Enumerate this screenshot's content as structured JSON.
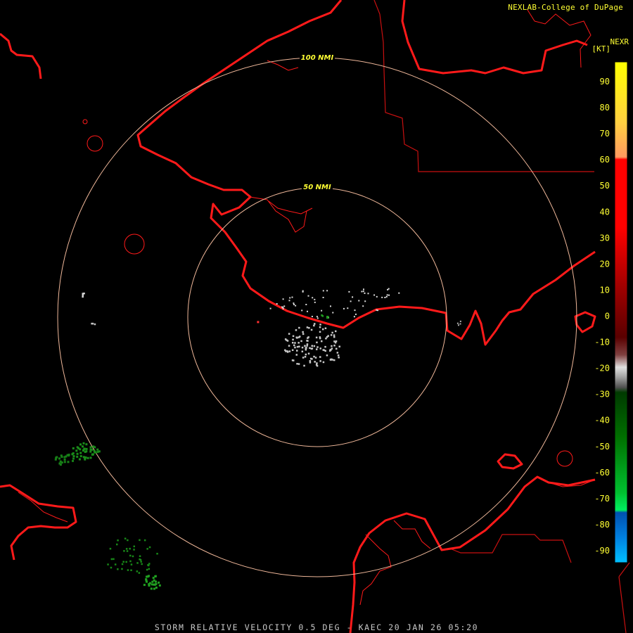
{
  "header": {
    "credit": "NEXLAB-College of DuPage",
    "product_code": "NEXR",
    "unit_label": "[KT]"
  },
  "range_rings": [
    {
      "label": "50 NMI"
    },
    {
      "label": "100 NMI"
    }
  ],
  "color_scale": {
    "tick_labels": [
      "90",
      "80",
      "70",
      "60",
      "50",
      "40",
      "30",
      "20",
      "10",
      "0",
      "-10",
      "-20",
      "-30",
      "-40",
      "-50",
      "-60",
      "-70",
      "-80",
      "-90"
    ],
    "tick_values": [
      90,
      80,
      70,
      60,
      50,
      40,
      30,
      20,
      10,
      0,
      -10,
      -20,
      -30,
      -40,
      -50,
      -60,
      -70,
      -80,
      -90
    ],
    "range": [
      -95,
      95
    ],
    "colors": {
      "high": "#ffff00",
      "outbound": "#ff0000",
      "near_zero": "#c8c8c8",
      "inbound": "#008c00",
      "strong_inbound": "#00c0ff"
    }
  },
  "caption": "STORM RELATIVE VELOCITY 0.5 DEG - KAEC 20 JAN 26 05:20",
  "colors": {
    "coastline": "#ff1a1a",
    "border": "#c81010",
    "ring": "#f0b89a",
    "text": "#ffff33",
    "caption": "#c8c8c8"
  }
}
